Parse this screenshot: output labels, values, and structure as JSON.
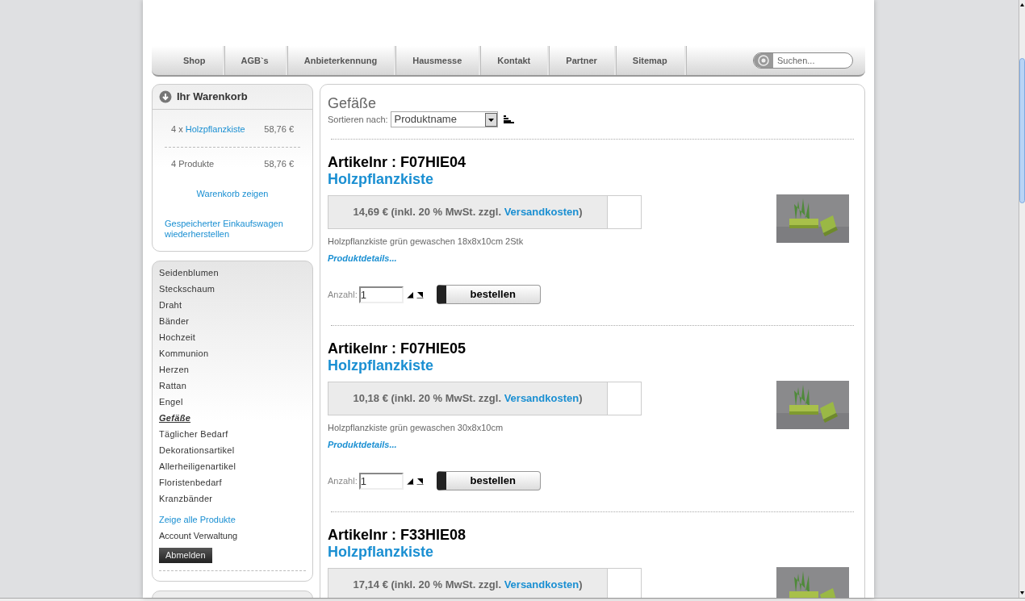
{
  "nav": {
    "items": [
      "Shop",
      "AGB`s",
      "Anbieterkennung",
      "Hausmesse",
      "Kontakt",
      "Partner",
      "Sitemap"
    ],
    "search": {
      "placeholder": "Suchen..."
    }
  },
  "cart": {
    "title": "Ihr Warenkorb",
    "lines": [
      {
        "qty": "4 x",
        "name": "Holzpflanzkiste",
        "price": "58,76 €"
      }
    ],
    "total_label": "4 Produkte",
    "total": "58,76 €",
    "show_link": "Warenkorb zeigen",
    "restore_link": "Gespeicherter Einkaufswagen wiederherstellen"
  },
  "categories": [
    {
      "label": "Seidenblumen",
      "selected": false
    },
    {
      "label": "Steckschaum",
      "selected": false
    },
    {
      "label": "Draht",
      "selected": false
    },
    {
      "label": "Bänder",
      "selected": false
    },
    {
      "label": "Hochzeit",
      "selected": false
    },
    {
      "label": "Kommunion",
      "selected": false
    },
    {
      "label": "Herzen",
      "selected": false
    },
    {
      "label": "Rattan",
      "selected": false
    },
    {
      "label": "Engel",
      "selected": false
    },
    {
      "label": "Gefäße",
      "selected": true
    },
    {
      "label": "Täglicher Bedarf",
      "selected": false
    },
    {
      "label": "Dekorationsartikel",
      "selected": false
    },
    {
      "label": "Allerheiligenartikel",
      "selected": false
    },
    {
      "label": "Floristenbedarf",
      "selected": false
    },
    {
      "label": "Kranzbänder",
      "selected": false
    }
  ],
  "account": {
    "all_products": "Zeige alle Produkte",
    "account": "Account Verwaltung",
    "logout": "Abmelden"
  },
  "main": {
    "title": "Gefäße",
    "sort_label": "Sortieren nach:",
    "sort_value": "Produktname"
  },
  "products": [
    {
      "article": "Artikelnr : F07HIE04",
      "name": "Holzpflanzkiste",
      "price": "14,69 € (inkl. 20 % MwSt. zzgl. ",
      "shipping": "Versandkosten",
      "price_end": ")",
      "description": "Holzpflanzkiste grün gewaschen 18x8x10cm 2Stk",
      "details": "Produktdetails...",
      "qty_label": "Anzahl:",
      "qty": "1",
      "order": "bestellen",
      "kind": "full"
    },
    {
      "article": "Artikelnr : F07HIE05",
      "name": "Holzpflanzkiste",
      "price": "10,18 € (inkl. 20 % MwSt. zzgl. ",
      "shipping": "Versandkosten",
      "price_end": ")",
      "description": "Holzpflanzkiste grün gewaschen 30x8x10cm",
      "details": "Produktdetails...",
      "qty_label": "Anzahl:",
      "qty": "1",
      "order": "bestellen",
      "kind": "full"
    },
    {
      "article": "Artikelnr : F33HIE08",
      "name": "Holzpflanzkiste",
      "price": "17,14 € (inkl. 20 % MwSt. zzgl. ",
      "shipping": "Versandkosten",
      "price_end": ")",
      "kind": "cut"
    }
  ]
}
